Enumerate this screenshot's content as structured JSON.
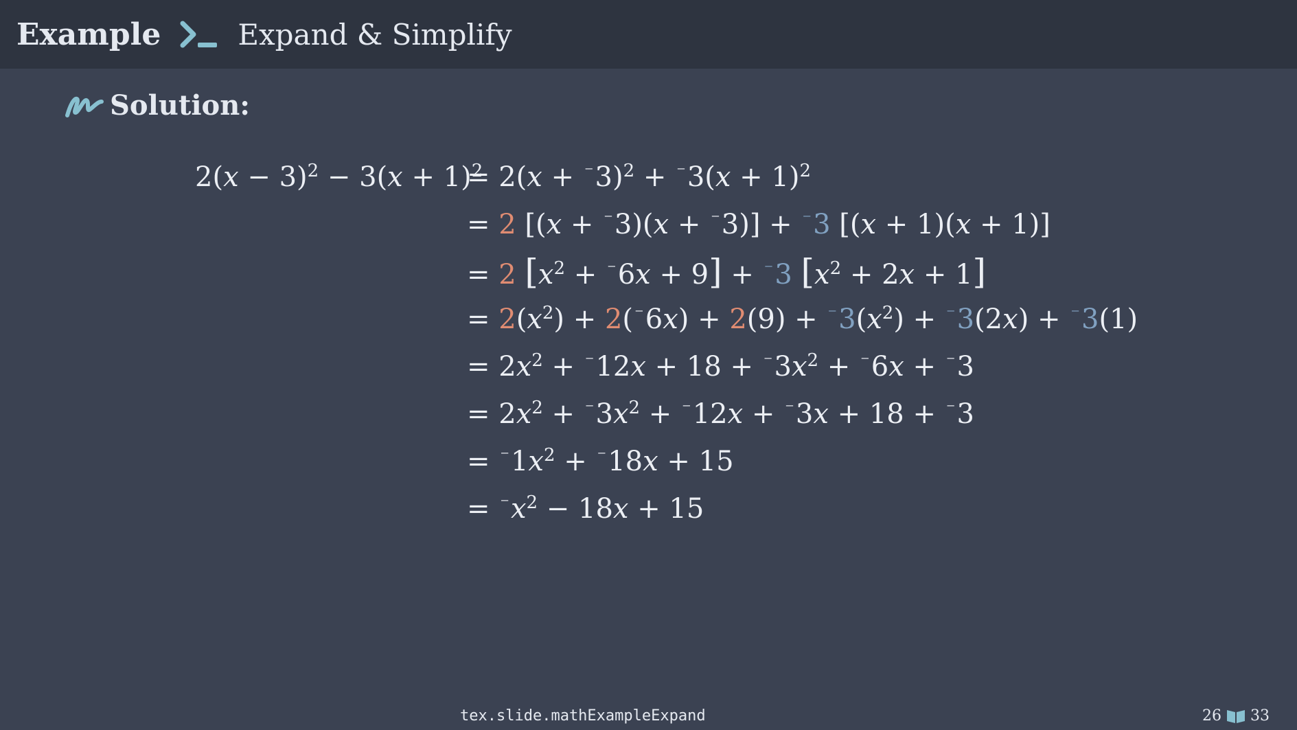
{
  "header": {
    "title": "Example",
    "subtitle": "Expand & Simplify"
  },
  "section": {
    "label": "Solution:"
  },
  "footer": {
    "source": "tex.slide.mathExampleExpand",
    "page_current": "26",
    "page_total": "33"
  },
  "colors": {
    "header_bg": "#2e3440",
    "body_bg": "#3b4252",
    "accent_orange": "#e08c72",
    "accent_blue": "#81a1c1",
    "icon": "#88c0d0"
  },
  "equations": [
    "2(x − 3)^2 − 3(x + 1)^2 = 2(x + ⁻3)^2 + ⁻3(x + 1)^2",
    "= 2 [(x + ⁻3)(x + ⁻3)] + ⁻3 [(x + 1)(x + 1)]",
    "= 2 [x^2 + ⁻6x + 9] + ⁻3 [x^2 + 2x + 1]",
    "= 2(x^2) + 2(⁻6x) + 2(9) + ⁻3(x^2) + ⁻3(2x) + ⁻3(1)",
    "= 2x^2 + ⁻12x + 18 + ⁻3x^2 + ⁻6x + ⁻3",
    "= 2x^2 + ⁻3x^2 + ⁻12x + ⁻3x + 18 + ⁻3",
    "= ⁻1x^2 + ⁻18x + 15",
    "= ⁻x^2 − 18x + 15"
  ]
}
